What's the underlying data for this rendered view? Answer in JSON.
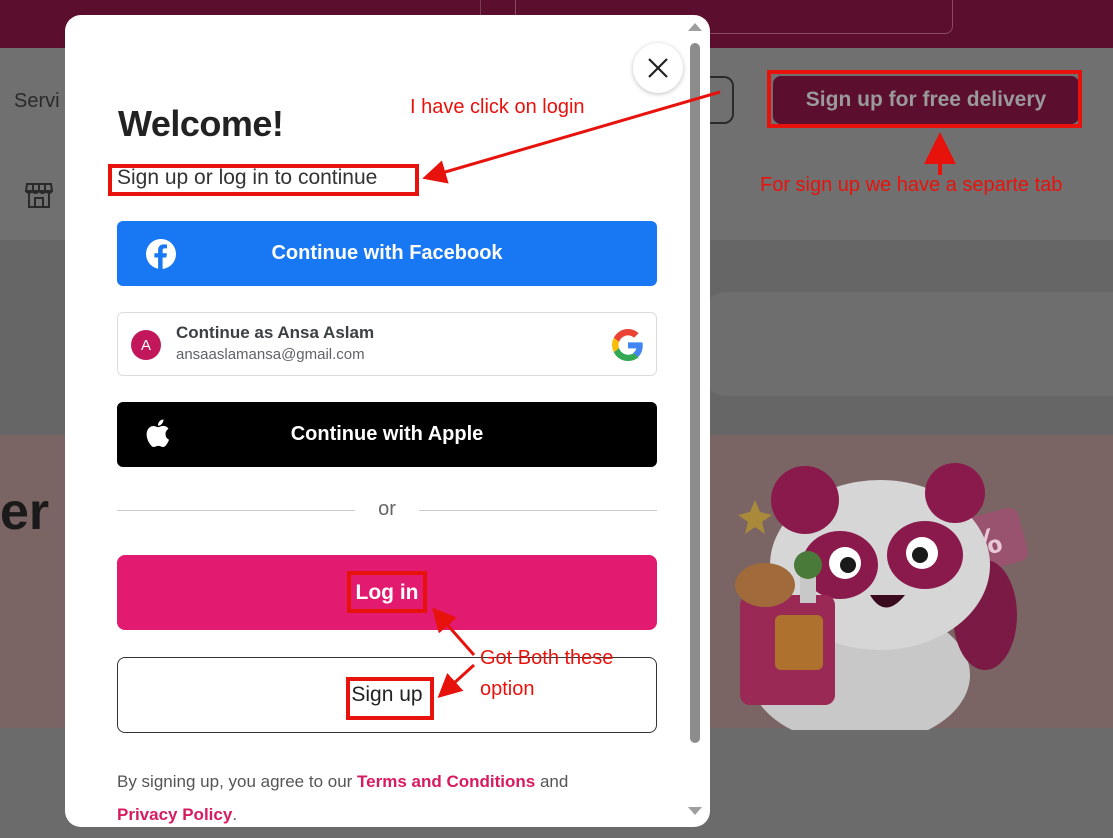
{
  "background": {
    "nav_partial_text": "Servi",
    "signup_delivery_label": "Sign up for free delivery",
    "hero_partial_text": "er"
  },
  "modal": {
    "title": "Welcome!",
    "subtitle": "Sign up or log in to continue",
    "facebook_label": "Continue with Facebook",
    "google": {
      "avatar_letter": "A",
      "name": "Continue as Ansa Aslam",
      "email": "ansaaslamansa@gmail.com"
    },
    "apple_label": "Continue with Apple",
    "or_label": "or",
    "login_label": "Log in",
    "signup_label": "Sign up",
    "legal": {
      "prefix": "By signing up, you agree to our ",
      "terms_link": "Terms and Conditions",
      "middle": " and",
      "privacy_link": "Privacy Policy",
      "suffix": "."
    }
  },
  "annotations": {
    "login_note": "I have click on login",
    "signup_note": "For sign up we have a separte tab",
    "both_note_line1": "Got Both these",
    "both_note_line2": "option"
  },
  "colors": {
    "brand_pink": "#e21b70",
    "facebook_blue": "#1877f2",
    "annotation_red": "#e8120c"
  }
}
